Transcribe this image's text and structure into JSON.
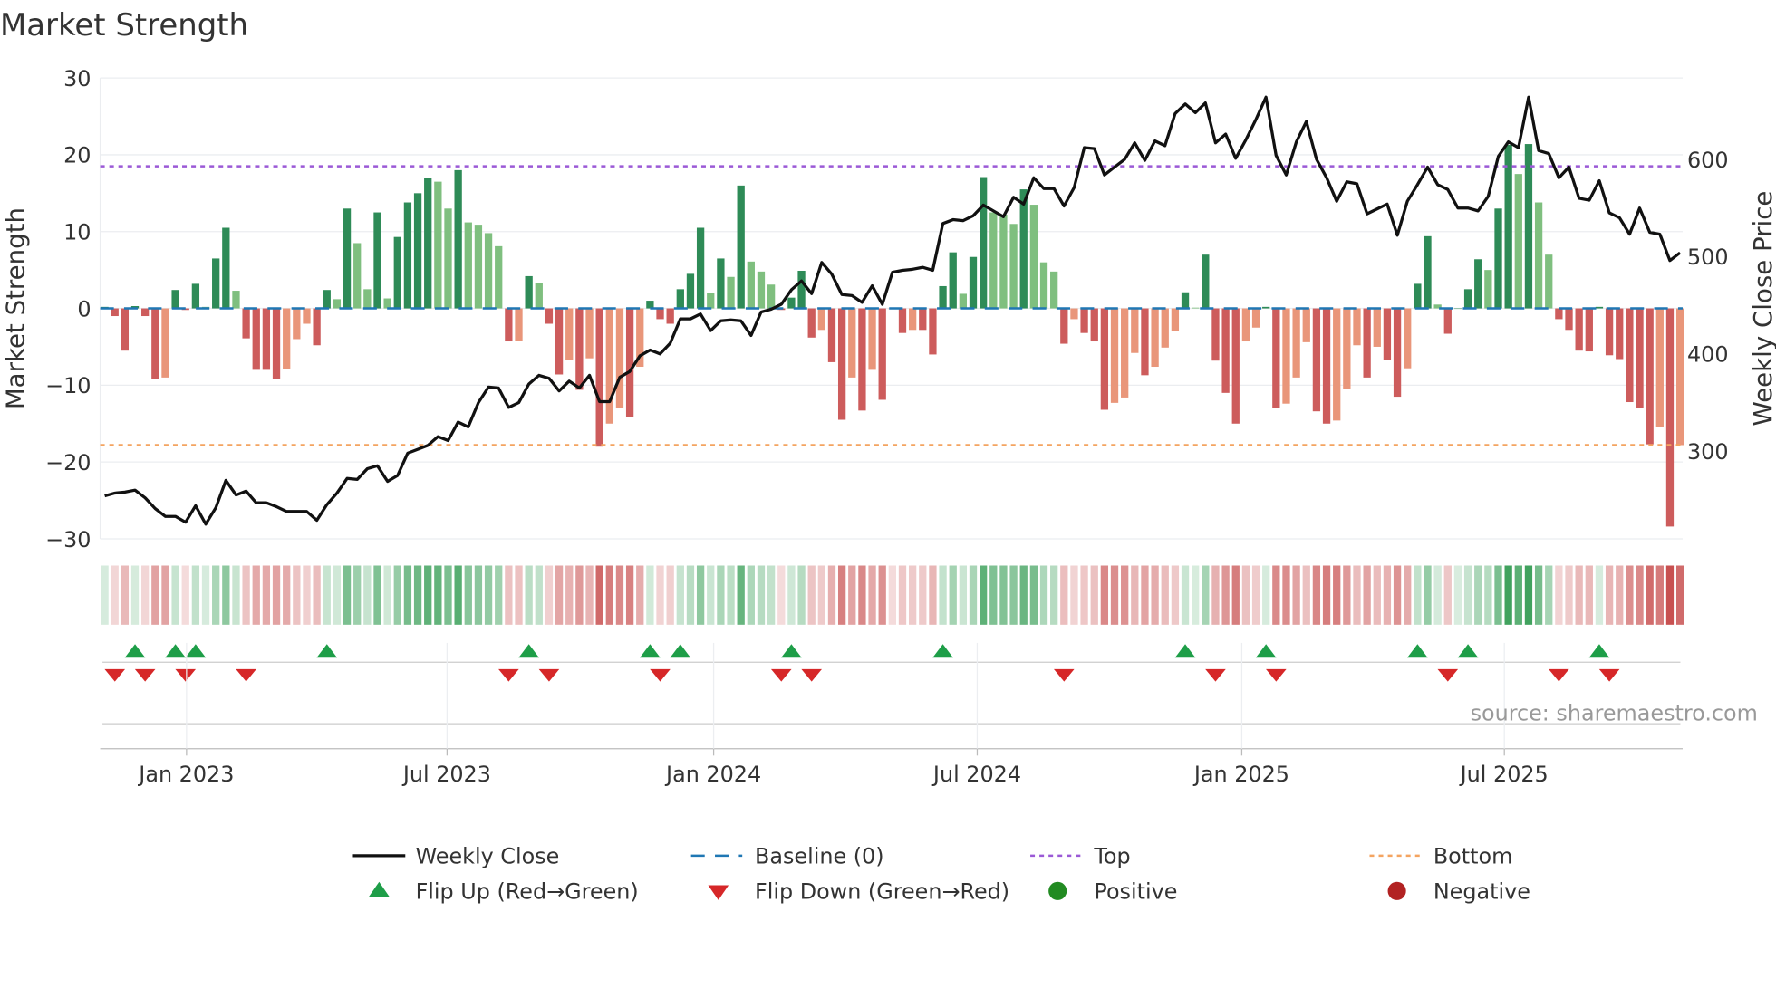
{
  "title": "Market Strength",
  "source": "source: sharemaestro.com",
  "legend": {
    "weekly_close": "Weekly Close",
    "baseline": "Baseline (0)",
    "top": "Top",
    "bottom": "Bottom",
    "flip_up": "Flip Up (Red→Green)",
    "flip_down": "Flip Down (Green→Red)",
    "positive": "Positive",
    "negative": "Negative"
  },
  "colors": {
    "strong_green": "#2e8b57",
    "weak_green": "#7fbf7f",
    "strong_red": "#cd5c5c",
    "weak_red": "#e9967a",
    "baseline": "#1f77b4",
    "top": "#9b59d6",
    "bottom": "#f4a460",
    "price": "#111111",
    "flip_up": "#1e9e48",
    "flip_down": "#d62728",
    "positive": "#228b22",
    "negative": "#b22222"
  },
  "chart_data": {
    "type": "bar",
    "title": "Market Strength",
    "ylabel": "Market Strength",
    "y2label": "Weekly Close Price",
    "ylim": [
      -30,
      30
    ],
    "y2lim": [
      209,
      683
    ],
    "yticks": [
      "30",
      "20",
      "10",
      "0",
      "−10",
      "−20",
      "−30"
    ],
    "ytick_values": [
      30,
      20,
      10,
      0,
      -10,
      -20,
      -30
    ],
    "y2ticks": [
      "600",
      "500",
      "400",
      "300"
    ],
    "y2tick_values": [
      600,
      500,
      400,
      300
    ],
    "xticks": [
      {
        "label": "Jan 2023",
        "week": 8.1
      },
      {
        "label": "Jul 2023",
        "week": 33.9
      },
      {
        "label": "Jan 2024",
        "week": 60.3
      },
      {
        "label": "Jul 2024",
        "week": 86.4
      },
      {
        "label": "Jan 2025",
        "week": 112.6
      },
      {
        "label": "Jul 2025",
        "week": 138.6
      }
    ],
    "top_level": 18.5,
    "bottom_level": -17.8,
    "baseline": 0,
    "strength": [
      0.2,
      -1,
      -5.5,
      0.3,
      -1,
      -9.2,
      -9,
      2.4,
      -0.2,
      3.2,
      0.2,
      6.5,
      10.5,
      2.3,
      -3.9,
      -8,
      -8,
      -9.2,
      -7.9,
      -4,
      -2,
      -4.8,
      2.4,
      1.2,
      13,
      8.5,
      2.5,
      12.5,
      1.3,
      9.3,
      13.8,
      15,
      17,
      16.5,
      13,
      18,
      11.2,
      10.9,
      9.8,
      8.1,
      -4.3,
      -4.2,
      4.2,
      3.3,
      -2,
      -8.6,
      -6.7,
      -10.6,
      -6.5,
      -18,
      -15,
      -13,
      -14.2,
      -7.6,
      1,
      -1.4,
      -2,
      2.5,
      4.5,
      10.5,
      2,
      6.5,
      4.1,
      16,
      6.1,
      4.8,
      3.1,
      -0.2,
      1.4,
      4.9,
      -3.8,
      -2.8,
      -7,
      -14.5,
      -9,
      -13.3,
      -8,
      -11.9,
      -0.1,
      -3.2,
      -2.8,
      -2.8,
      -6,
      2.9,
      7.3,
      1.9,
      6.7,
      17.1,
      12.5,
      12.2,
      11,
      15.5,
      13.5,
      6,
      4.8,
      -4.6,
      -1.4,
      -3.2,
      -4.3,
      -13.2,
      -12.3,
      -11.6,
      -5.8,
      -8.7,
      -7.6,
      -5.1,
      -2.9,
      2.1,
      0.1,
      7,
      -6.8,
      -11,
      -15,
      -4.3,
      -2.5,
      0.2,
      -13,
      -12.4,
      -9,
      -4.4,
      -13.4,
      -15,
      -14.6,
      -10.5,
      -4.8,
      -9,
      -5,
      -6.7,
      -11.5,
      -7.8,
      3.2,
      9.4,
      0.5,
      -3.3,
      0,
      2.5,
      6.4,
      5,
      13,
      21.3,
      17.5,
      21.4,
      13.8,
      7,
      -1.4,
      -2.8,
      -5.5,
      -5.6,
      0.2,
      -6.1,
      -6.6,
      -12.2,
      -13,
      -17.7,
      -15.4,
      -28.4,
      -17.8
    ],
    "weekly_close": [
      254,
      257,
      258,
      260,
      252,
      241,
      233,
      233,
      227,
      244,
      225,
      242,
      270,
      255,
      259,
      247,
      247,
      243,
      238,
      238,
      238,
      229,
      245,
      257,
      272,
      271,
      282,
      285,
      269,
      275,
      298,
      302,
      306,
      315,
      311,
      330,
      325,
      350,
      366,
      365,
      345,
      350,
      369,
      378,
      375,
      362,
      372,
      365,
      378,
      351,
      351,
      376,
      382,
      398,
      404,
      400,
      411,
      436,
      436,
      441,
      424,
      434,
      435,
      434,
      419,
      443,
      446,
      451,
      466,
      475,
      462,
      494,
      482,
      461,
      460,
      453,
      470,
      451,
      484,
      486,
      487,
      489,
      486,
      534,
      538,
      537,
      542,
      553,
      547,
      541,
      561,
      554,
      581,
      570,
      570,
      552,
      571,
      612,
      611,
      584,
      592,
      600,
      617,
      599,
      619,
      614,
      647,
      657,
      648,
      658,
      617,
      626,
      601,
      620,
      641,
      664,
      604,
      584,
      618,
      639,
      600,
      581,
      557,
      577,
      575,
      544,
      549,
      554,
      522,
      557,
      574,
      592,
      574,
      569,
      550,
      550,
      547,
      562,
      603,
      618,
      612,
      664,
      609,
      606,
      581,
      592,
      560,
      558,
      578,
      545,
      540,
      523,
      550,
      525,
      523,
      496,
      504
    ],
    "flip_up_weeks": [
      3,
      7,
      9,
      22,
      42,
      54,
      57,
      68,
      83,
      107,
      115,
      130,
      135,
      148
    ],
    "flip_down_weeks": [
      1,
      4,
      8,
      14,
      40,
      44,
      55,
      67,
      70,
      95,
      110,
      116,
      133,
      144,
      149
    ],
    "legend_placement": "bottom"
  }
}
